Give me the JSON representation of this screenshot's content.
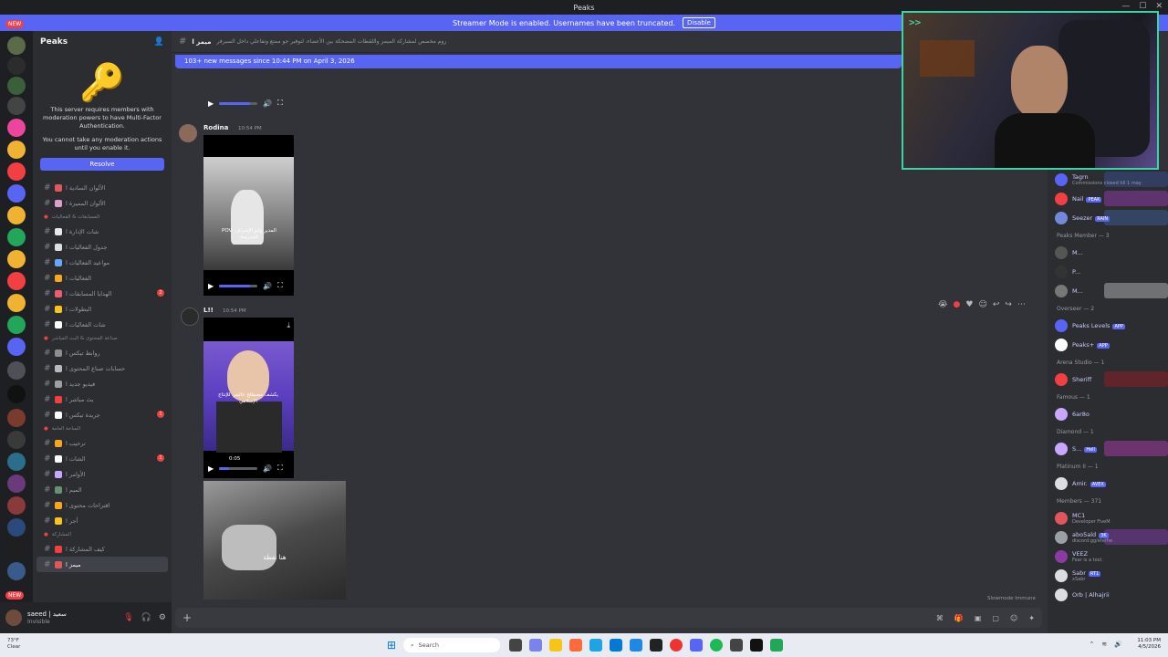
{
  "window": {
    "title": "Peaks"
  },
  "banner": {
    "text": "Streamer Mode is enabled. Usernames have been truncated.",
    "disable_label": "Disable"
  },
  "rail": {
    "new_badge": "NEW",
    "bottom_new_badge": "NEW"
  },
  "guild": {
    "name": "Peaks"
  },
  "mfa": {
    "line1": "This server requires members with moderation powers to have Multi-Factor Authentication.",
    "line2": "You cannot take any moderation actions until you enable it.",
    "resolve_label": "Resolve"
  },
  "channels": [
    {
      "kind": "ch",
      "label": "الألوان السادية ا",
      "color": "#e0575b"
    },
    {
      "kind": "ch",
      "label": "الألوان المميزة ا",
      "color": "#d9a1c8"
    },
    {
      "kind": "cat",
      "label": "المسابقات & الفعاليات"
    },
    {
      "kind": "ch",
      "label": "شات الإدارة ا",
      "color": "#e8e8e8"
    },
    {
      "kind": "ch",
      "label": "جدول الفعاليات ا",
      "color": "#dedede"
    },
    {
      "kind": "ch",
      "label": "مواعيد الفعاليات ا",
      "color": "#6aa6ff"
    },
    {
      "kind": "ch",
      "label": "الفعاليات ا",
      "color": "#f5a623"
    },
    {
      "kind": "ch",
      "label": "الهدايا المسابقات ا",
      "color": "#e85d75",
      "badge": "2"
    },
    {
      "kind": "ch",
      "label": "البطولات ا",
      "color": "#f5c518"
    },
    {
      "kind": "ch",
      "label": "شات الفعاليات ا",
      "color": "#ffffff"
    },
    {
      "kind": "cat",
      "label": "صناعة المحتوى & البث المباشر"
    },
    {
      "kind": "ch",
      "label": "روابط تيكس ا",
      "color": "#8e8e8e"
    },
    {
      "kind": "ch",
      "label": "حسابات صناع المحتوى ا",
      "color": "#b5bac1"
    },
    {
      "kind": "ch",
      "label": "فيديو جديد ا",
      "color": "#9aa0a6"
    },
    {
      "kind": "ch",
      "label": "بث مباشر ا",
      "color": "#f23f43"
    },
    {
      "kind": "ch",
      "label": "جريدة تيكس ا",
      "color": "#ffffff",
      "badge": "1"
    },
    {
      "kind": "cat",
      "label": "الساحة العامة"
    },
    {
      "kind": "ch",
      "label": "ترحيب ا",
      "color": "#f5a623"
    },
    {
      "kind": "ch",
      "label": "الشات ا",
      "color": "#ffffff",
      "badge": "1"
    },
    {
      "kind": "ch",
      "label": "الأوامر ا",
      "color": "#c9a6ff"
    },
    {
      "kind": "ch",
      "label": "الميم ا",
      "color": "#6b8f71"
    },
    {
      "kind": "ch",
      "label": "اقتراحات محتوى ا",
      "color": "#f5a623"
    },
    {
      "kind": "ch",
      "label": "أجر ا",
      "color": "#f5c518"
    },
    {
      "kind": "cat",
      "label": "المشاركة"
    },
    {
      "kind": "ch",
      "label": "كيف المشاركة ا",
      "color": "#f23f43"
    },
    {
      "kind": "ch",
      "label": "ميمز ا",
      "color": "#e0575b",
      "active": true
    }
  ],
  "user": {
    "name": "saeed | سعيد",
    "status": "Invisible"
  },
  "chat": {
    "channel_name": "ميمز ا",
    "topic": "روم مخصص لمشاركة الميمز واللقطات المضحكة بين الأعضاء، لتوفير جو ممتع وتفاعلي داخل السيرفر",
    "new_messages": "103+ new messages since 10:44 PM on April 3, 2026",
    "messages": [
      {
        "author": "Rodina",
        "time": "10:54 PM",
        "video_caption": "POV: المدير وابو الإشراف للمدرسة"
      },
      {
        "author": "L!!",
        "time": "10:54 PM",
        "video_time": "0:05",
        "video_progress": 0.25,
        "video_caption": "يكشف مصطلح عالمي للإنتاج الإسلامي"
      },
      {
        "author": "",
        "time": "",
        "video_caption": "هنا نقطة"
      }
    ],
    "slowmode": "Slowmode Immune",
    "composer_placeholder": ""
  },
  "webcam": {
    "prompt": ">>"
  },
  "members": {
    "groups": [
      {
        "title": "",
        "items": [
          {
            "name": "Tagrn",
            "sub": "Commissions closed till 1 may",
            "color": "#5865f2",
            "band": "#3b4a8a"
          },
          {
            "name": "Nail",
            "tag": "PEAK",
            "sub": "",
            "color": "#f23f43",
            "band": "#8a3ba0"
          },
          {
            "name": "Seezer",
            "tag": "RAIN",
            "sub": "",
            "color": "#7289da",
            "band": "#3a5a8a"
          }
        ]
      },
      {
        "title": "Peaks Member — 3",
        "items": [
          {
            "name": "M...",
            "sub": "",
            "color": "#555",
            "band": ""
          },
          {
            "name": "P...",
            "sub": "",
            "color": "#333",
            "band": ""
          },
          {
            "name": "M...",
            "sub": "",
            "color": "#777",
            "band": "#aaaaaa"
          }
        ]
      },
      {
        "title": "Overseer — 2",
        "items": [
          {
            "name": "Peaks Levels",
            "tag": "APP",
            "sub": "",
            "color": "#5865f2",
            "band": ""
          },
          {
            "name": "Peaks+",
            "tag": "APP",
            "sub": "",
            "color": "#ffffff",
            "band": ""
          }
        ]
      },
      {
        "title": "Arena Studio — 1",
        "items": [
          {
            "name": "Sheriff",
            "sub": "",
            "color": "#f23f43",
            "band": "#8a1f25"
          }
        ]
      },
      {
        "title": "Famous — 1",
        "items": [
          {
            "name": "6ar8o",
            "sub": "",
            "color": "#c9a6ff",
            "band": ""
          }
        ]
      },
      {
        "title": "Diamond — 1",
        "items": [
          {
            "name": "S...",
            "tag": "Hell",
            "sub": "",
            "color": "#c9a6ff",
            "band": "#a03ba0"
          }
        ]
      },
      {
        "title": "Platinum II — 1",
        "items": [
          {
            "name": "Amir.",
            "tag": "AVEX",
            "sub": "",
            "color": "#dbdee1",
            "band": ""
          }
        ]
      },
      {
        "title": "Members — 371",
        "items": [
          {
            "name": "MC1",
            "sub": "Developer FiveM",
            "color": "#e0575b",
            "band": ""
          },
          {
            "name": "abo5ald",
            "tag": "3K",
            "sub": "discord.gg/eterhe",
            "color": "#9aa0a6",
            "band": "#7a3ba0"
          },
          {
            "name": "VEEZ",
            "sub": "Fear is a tool.",
            "color": "#8a3ba0",
            "band": ""
          },
          {
            "name": "Sabr",
            "tag": "RT1",
            "sub": "xSabr",
            "color": "#dbdee1",
            "band": ""
          },
          {
            "name": "Orb | Alhajrii",
            "sub": "",
            "color": "#dbdee1",
            "band": ""
          }
        ]
      }
    ]
  },
  "taskbar": {
    "weather_temp": "73°F",
    "weather_desc": "Clear",
    "search_placeholder": "Search",
    "time": "11:03 PM",
    "date": "4/5/2026"
  },
  "colors": {
    "accent": "#5865f2",
    "webcam_border": "#3cd4a6",
    "danger": "#f23f43"
  }
}
